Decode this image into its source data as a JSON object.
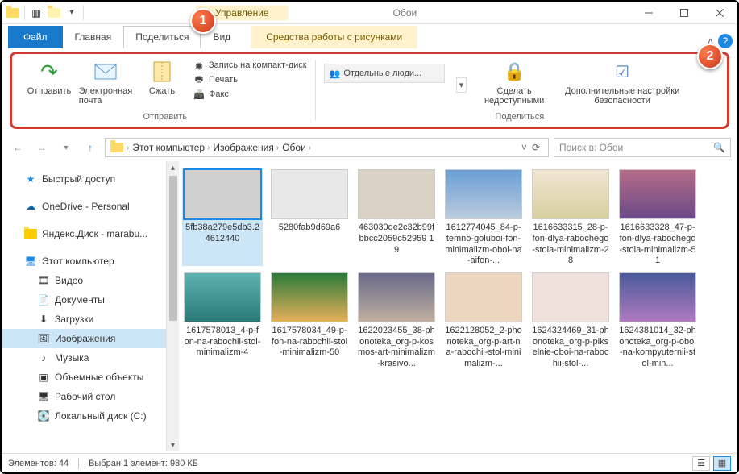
{
  "window": {
    "contextTab": "Управление",
    "title": "Обои"
  },
  "tabs": {
    "file": "Файл",
    "home": "Главная",
    "share": "Поделиться",
    "view": "Вид",
    "tools": "Средства работы с рисунками"
  },
  "ribbon": {
    "group_send": "Отправить",
    "group_share": "Поделиться",
    "send": "Отправить",
    "email": "Электронная почта",
    "zip": "Сжать",
    "burn": "Запись на компакт-диск",
    "print": "Печать",
    "fax": "Факс",
    "specific": "Отдельные люди...",
    "remove": "Сделать недоступными",
    "advanced": "Дополнительные настройки безопасности"
  },
  "markers": {
    "m1": "1",
    "m2": "2"
  },
  "address": {
    "seg1": "Этот компьютер",
    "seg2": "Изображения",
    "seg3": "Обои",
    "search_placeholder": "Поиск в: Обои"
  },
  "nav": {
    "quick": "Быстрый доступ",
    "onedrive": "OneDrive - Personal",
    "yandex": "Яндекс.Диск - marabu...",
    "thispc": "Этот компьютер",
    "video": "Видео",
    "docs": "Документы",
    "downloads": "Загрузки",
    "pictures": "Изображения",
    "music": "Музыка",
    "objects3d": "Объемные объекты",
    "desktop": "Рабочий стол",
    "diskC": "Локальный диск (C:)"
  },
  "items": [
    {
      "name": "5fb38a279e5db3.24612440",
      "sel": true,
      "cls": "t1"
    },
    {
      "name": "5280fab9d69a6",
      "cls": "t2"
    },
    {
      "name": "463030de2c32b99fbbcc2059c52959 19",
      "cls": "t3"
    },
    {
      "name": "1612774045_84-p-temno-goluboi-fon-minimalizm-oboi-na-aifon-...",
      "cls": "t4"
    },
    {
      "name": "1616633315_28-p-fon-dlya-rabochego-stola-minimalizm-28",
      "cls": "t5"
    },
    {
      "name": "1616633328_47-p-fon-dlya-rabochego-stola-minimalizm-51",
      "cls": "t6"
    },
    {
      "name": "1617578013_4-p-fon-na-rabochii-stol-minimalizm-4",
      "cls": "t7"
    },
    {
      "name": "1617578034_49-p-fon-na-rabochii-stol-minimalizm-50",
      "cls": "t8"
    },
    {
      "name": "1622023455_38-phonoteka_org-p-kosmos-art-minimalizm-krasivo...",
      "cls": "t9"
    },
    {
      "name": "1622128052_2-phonoteka_org-p-art-na-rabochii-stol-minimalizm-...",
      "cls": "t10"
    },
    {
      "name": "1624324469_31-phonoteka_org-p-pikselnie-oboi-na-rabochii-stol-...",
      "cls": "t11"
    },
    {
      "name": "1624381014_32-phonoteka_org-p-oboi-na-kompyuternii-stol-min...",
      "cls": "t12"
    }
  ],
  "status": {
    "count": "Элементов: 44",
    "selected": "Выбран 1 элемент: 980 КБ"
  }
}
